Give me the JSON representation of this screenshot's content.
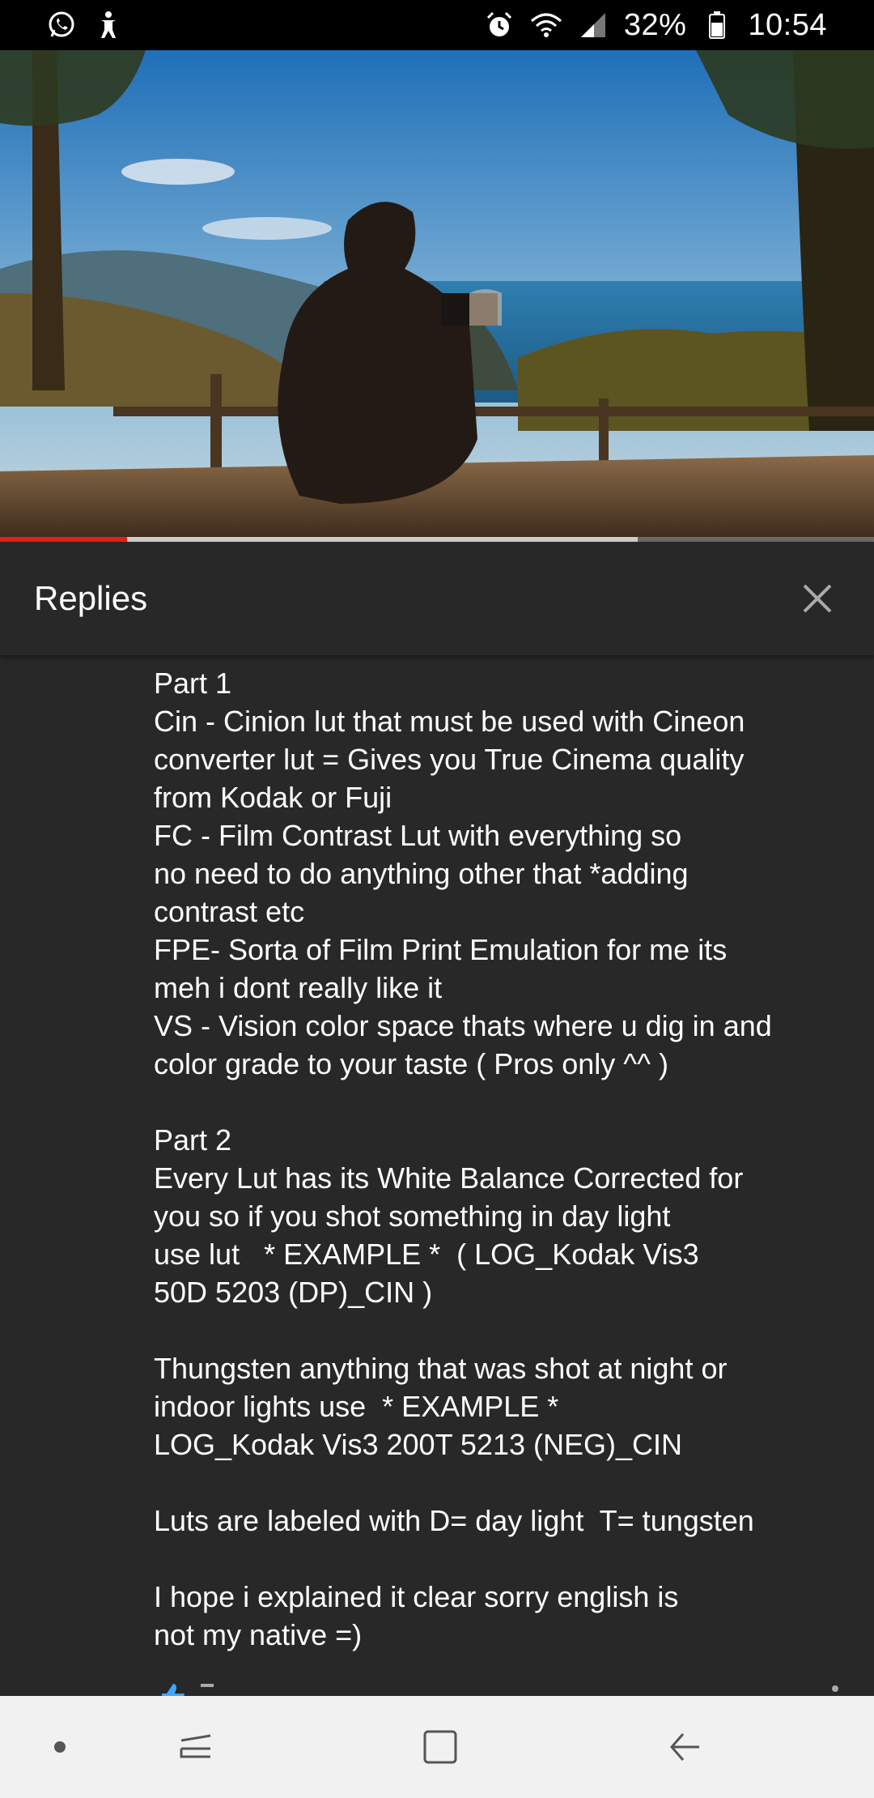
{
  "status_bar": {
    "battery_percent": "32%",
    "time": "10:54",
    "icons": [
      "whatsapp-icon",
      "accessibility-icon",
      "alarm-icon",
      "wifi-icon",
      "signal-icon",
      "battery-icon"
    ]
  },
  "video": {
    "played_fraction": 0.145,
    "buffered_fraction": 0.73
  },
  "replies_panel": {
    "title": "Replies",
    "close_icon": "close-icon"
  },
  "reply": {
    "text": "Part 1\nCin - Cinion lut that must be used with Cineon\nconverter lut = Gives you True Cinema quality\nfrom Kodak or Fuji\nFC - Film Contrast Lut with everything so\nno need to do anything other that *adding\ncontrast etc\nFPE- Sorta of Film Print Emulation for me its\nmeh i dont really like it\nVS - Vision color space thats where u dig in and\ncolor grade to your taste ( Pros only ^^ )\n\nPart 2\nEvery Lut has its White Balance Corrected for\nyou so if you shot something in day light\nuse lut   * EXAMPLE *  ( LOG_Kodak Vis3\n50D 5203 (DP)_CIN )\n\nThungsten anything that was shot at night or\nindoor lights use  * EXAMPLE *\nLOG_Kodak Vis3 200T 5213 (NEG)_CIN\n\nLuts are labeled with D= day light  T= tungsten\n\nI hope i explained it clear sorry english is\nnot my native =)"
  },
  "nav_bar": {
    "buttons": [
      "dot-icon",
      "recent-apps-icon",
      "home-icon",
      "back-icon"
    ]
  },
  "colors": {
    "background": "#282828",
    "progress_played": "#e62117",
    "nav_bar": "#f1f1f1"
  }
}
